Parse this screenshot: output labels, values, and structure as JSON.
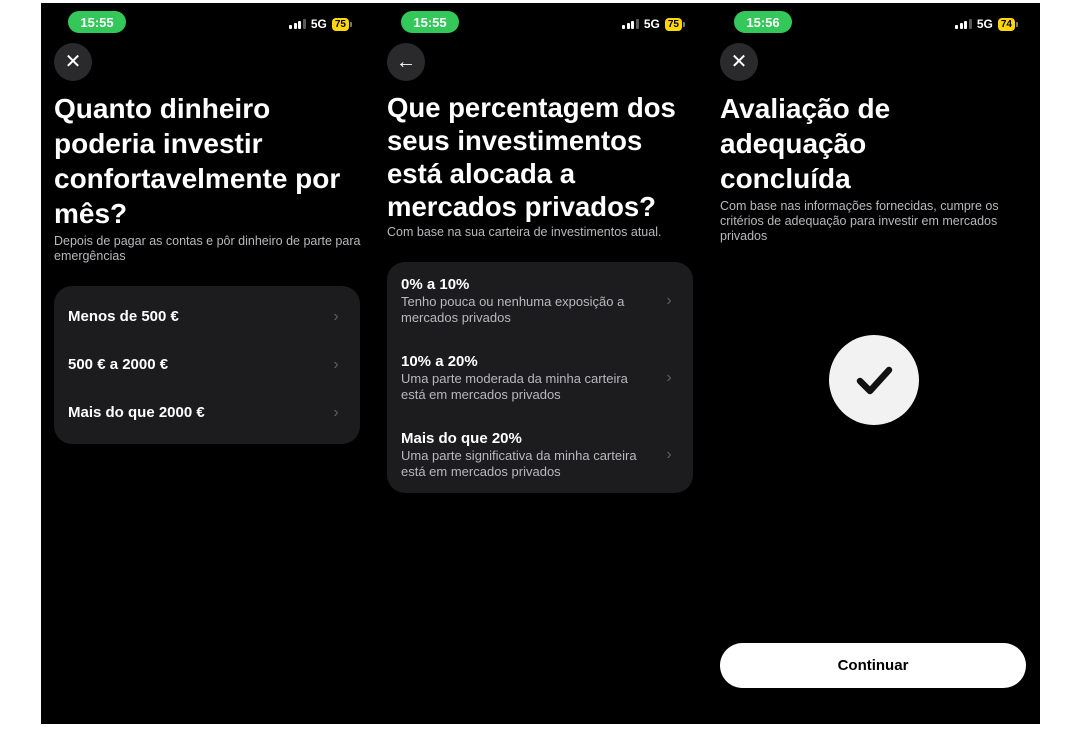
{
  "screens": [
    {
      "status": {
        "time": "15:55",
        "network": "5G",
        "battery": "75"
      },
      "nav_icon": "close-icon",
      "nav_glyph": "✕",
      "title": "Quanto dinheiro poderia investir confortavelmente por mês?",
      "subtitle": "Depois de pagar as contas e pôr dinheiro de parte para emergências",
      "options": [
        {
          "label": "Menos de 500 €"
        },
        {
          "label": "500 € a 2000 €"
        },
        {
          "label": "Mais do que 2000 €"
        }
      ]
    },
    {
      "status": {
        "time": "15:55",
        "network": "5G",
        "battery": "75"
      },
      "nav_icon": "back-arrow-icon",
      "nav_glyph": "←",
      "title": "Que percentagem dos seus investimentos está alocada a mercados privados?",
      "subtitle": "Com base na sua carteira de investimentos atual.",
      "options": [
        {
          "label": "0% a 10%",
          "desc": "Tenho pouca ou nenhuma exposição a mercados privados"
        },
        {
          "label": "10% a 20%",
          "desc": "Uma parte moderada da minha carteira está em mercados privados"
        },
        {
          "label": "Mais do que 20%",
          "desc": "Uma parte significativa da minha carteira está em mercados privados"
        }
      ]
    },
    {
      "status": {
        "time": "15:56",
        "network": "5G",
        "battery": "74"
      },
      "nav_icon": "close-icon",
      "nav_glyph": "✕",
      "title": "Avaliação de adequação concluída",
      "subtitle": "Com base nas informações fornecidas, cumpre os critérios de adequação para investir em mercados privados",
      "icon": "checkmark-icon",
      "button_label": "Continuar"
    }
  ],
  "colors": {
    "background": "#000000",
    "card": "#1c1c1e",
    "status_time_pill": "#34c759",
    "battery": "#ffd60a",
    "primary_button": "#ffffff"
  }
}
